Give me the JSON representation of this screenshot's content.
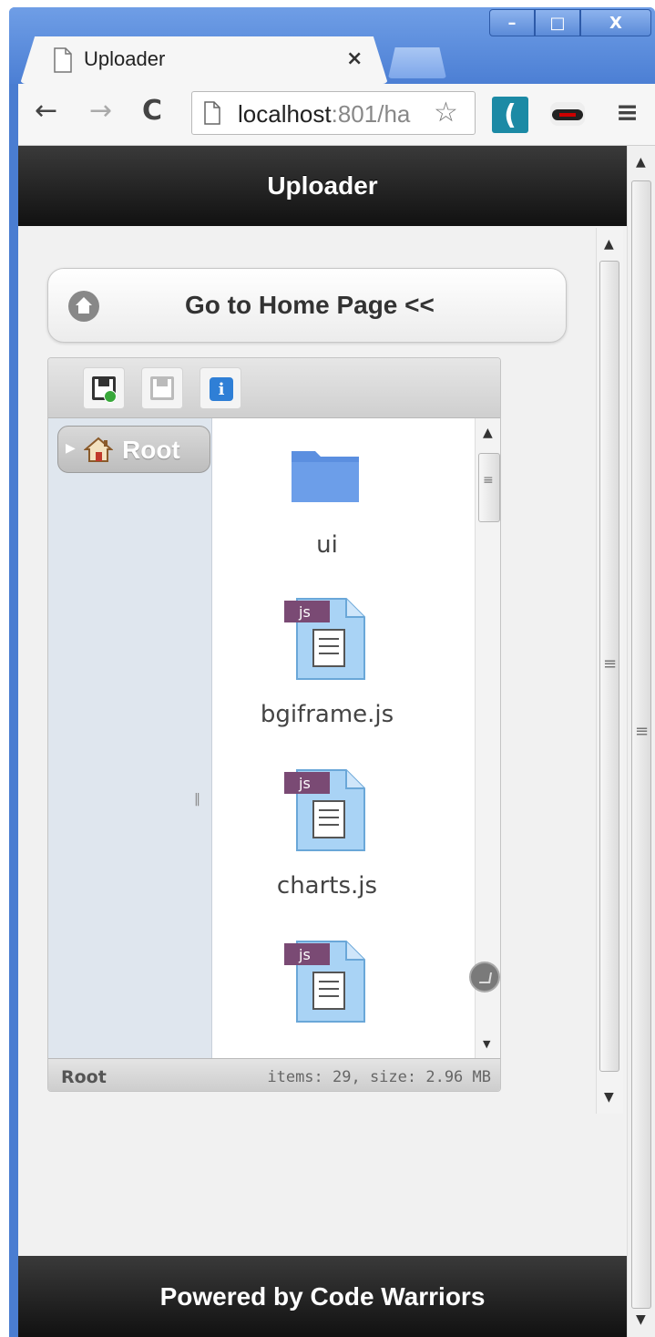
{
  "browser": {
    "tab_title": "Uploader",
    "tab_close": "×",
    "url_host": "localhost",
    "url_rest": ":801/ha",
    "nav": {
      "back": "←",
      "forward": "→",
      "reload": "C",
      "menu": "≡",
      "star": "☆"
    },
    "window": {
      "minimize": "–",
      "maximize": "□",
      "close": "X"
    }
  },
  "header": {
    "title": "Uploader"
  },
  "home_button": {
    "label": "Go to Home Page <<"
  },
  "file_manager": {
    "toolbar": {
      "buttons": [
        "save-new",
        "save",
        "info"
      ]
    },
    "tree": {
      "root_label": "Root"
    },
    "files": [
      {
        "name": "ui",
        "type": "folder"
      },
      {
        "name": "bgiframe.js",
        "type": "js"
      },
      {
        "name": "charts.js",
        "type": "js"
      },
      {
        "name": "",
        "type": "js"
      }
    ],
    "js_badge": "js",
    "status": {
      "path": "Root",
      "info": "items: 29, size: 2.96 MB"
    }
  },
  "footer": {
    "text": "Powered by Code Warriors"
  },
  "colors": {
    "chrome_blue": "#4a7dd1",
    "header_bg": "#1a1a1a",
    "tree_bg": "#dfe6ee",
    "folder": "#5b8fe0",
    "js_badge": "#7a4a74"
  }
}
